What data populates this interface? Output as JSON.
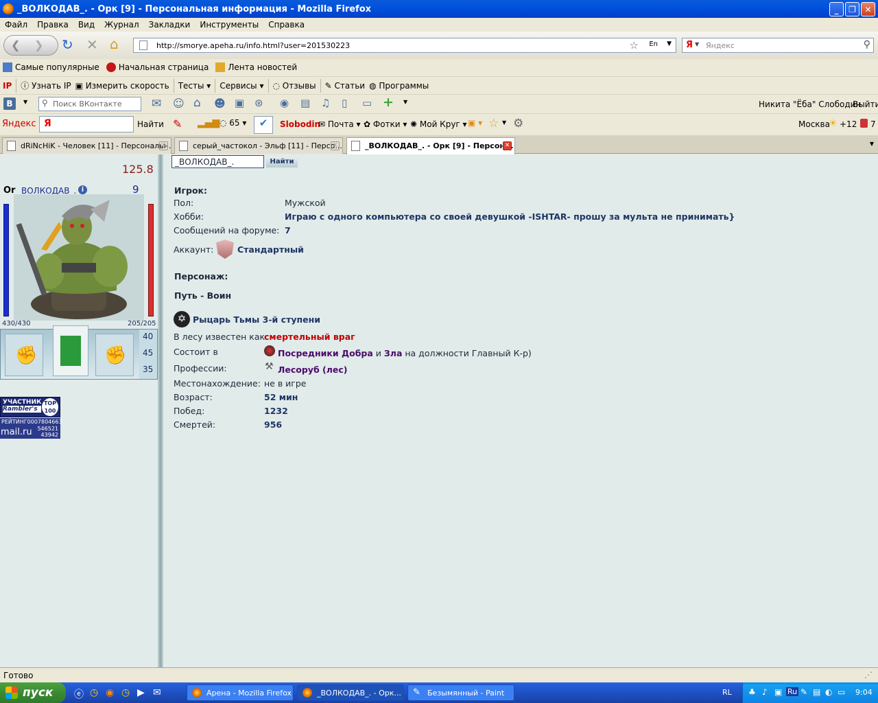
{
  "window": {
    "title": "_ВОЛКОДАВ_. - Орк [9] - Персональная информация - Mozilla Firefox"
  },
  "menu": [
    "Файл",
    "Правка",
    "Вид",
    "Журнал",
    "Закладки",
    "Инструменты",
    "Справка"
  ],
  "nav": {
    "url": "http://smorye.apeha.ru/info.html?user=201530223",
    "url_suffix": "En",
    "search_placeholder": "Яндекс"
  },
  "bookmarks": [
    "Самые популярные",
    "Начальная страница",
    "Лента новостей"
  ],
  "toolbar2": {
    "ip": "Узнать IP",
    "speed": "Измерить скорость",
    "tests": "Тесты",
    "services": "Сервисы",
    "reviews": "Отзывы",
    "articles": "Статьи",
    "programs": "Программы"
  },
  "vk": {
    "badge": "B",
    "search_placeholder": "Поиск ВКонтакте",
    "user": "Никита \"Ёба\" Слободин",
    "logout": "Выйти"
  },
  "yandex": {
    "logo": "Яндекс",
    "find": "Найти",
    "count": "65",
    "user": "Slobodin",
    "mail": "Почта",
    "photos": "Фотки",
    "circle": "Мой Круг",
    "city": "Москва",
    "temp": "+12",
    "mail_count": "7"
  },
  "tabs": [
    {
      "label": "dRiNcHiK - Человек [11] - Персональн..."
    },
    {
      "label": "серый_частокол - Эльф [11] - Персо..."
    },
    {
      "label": "_ВОЛКОДАВ_. - Орк [9] - Персон..."
    }
  ],
  "char": {
    "score": "125.8",
    "race": "Or",
    "name": "_ВОЛКОДАВ_.",
    "level": "9",
    "hp": "430/430",
    "mana": "205/205",
    "stats": [
      "40",
      "45",
      "35"
    ]
  },
  "banners": {
    "rambler_title": "УЧАСТНИК",
    "rambler_name": "Rambler's",
    "rambler_top": "TOP",
    "rambler_num": "100",
    "rating_label": "РЕЙТИНГ",
    "rating_code": "0007804663",
    "mail": "mail.ru",
    "mail_n1": "546521",
    "mail_n2": "43942"
  },
  "search": {
    "value": "_ВОЛКОДАВ_.",
    "button": "Найти"
  },
  "player": {
    "heading": "Игрок:",
    "rows": [
      {
        "label": "Пол:",
        "value": "Мужской"
      },
      {
        "label": "Хобби:",
        "value": "Играю с одного компьютера со своей девушкой -ISHTAR- прошу за мульта не принимать}"
      },
      {
        "label": "Сообщений на форуме:",
        "value": "7"
      }
    ],
    "account_label": "Аккаунт:",
    "account_value": "Стандартный"
  },
  "character": {
    "heading": "Персонаж:",
    "path": "Путь - Воин",
    "rank": "Рыцарь Тьмы 3-й ступени",
    "forest_label": "В лесу известен как",
    "forest_value": "смертельный враг",
    "clan_label": "Состоит в",
    "clan_a": "Посредники Добра",
    "clan_and": "и",
    "clan_b": "Зла",
    "clan_post": "на должности Главный К-р)",
    "prof_label": "Профессии:",
    "prof_value": "Лесоруб (лес)",
    "rows": [
      {
        "label": "Местонахождение:",
        "value": "не в игре"
      },
      {
        "label": "Возраст:",
        "value": "52 мин"
      },
      {
        "label": "Побед:",
        "value": "1232"
      },
      {
        "label": "Смертей:",
        "value": "956"
      }
    ]
  },
  "status": "Готово",
  "taskbar": {
    "start": "пуск",
    "items": [
      {
        "label": "Арена - Mozilla Firefox"
      },
      {
        "label": "_ВОЛКОДАВ_. - Орк..."
      },
      {
        "label": "Безымянный - Paint"
      }
    ],
    "lang": "RL",
    "tray_lang": "Ru",
    "time": "9:04"
  },
  "colors": {
    "accent_red": "#c00000",
    "link_purple": "#4b0a6a",
    "title_blue": "#0052e0"
  }
}
